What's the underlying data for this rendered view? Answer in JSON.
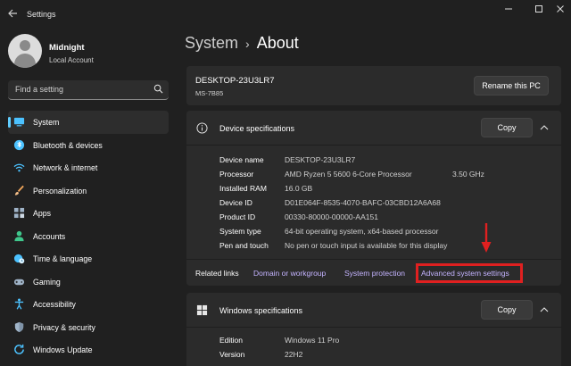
{
  "window": {
    "title": "Settings"
  },
  "profile": {
    "name": "Midnight",
    "account_type": "Local Account"
  },
  "search": {
    "placeholder": "Find a setting"
  },
  "nav": {
    "items": [
      {
        "label": "System",
        "icon": "monitor-icon",
        "color": "#4cc2ff"
      },
      {
        "label": "Bluetooth & devices",
        "icon": "bluetooth-icon",
        "color": "#4cc2ff"
      },
      {
        "label": "Network & internet",
        "icon": "wifi-icon",
        "color": "#4cc2ff"
      },
      {
        "label": "Personalization",
        "icon": "brush-icon",
        "color": "#f2a65a"
      },
      {
        "label": "Apps",
        "icon": "apps-icon",
        "color": "#a0b4c8"
      },
      {
        "label": "Accounts",
        "icon": "person-icon",
        "color": "#3fc78c"
      },
      {
        "label": "Time & language",
        "icon": "globe-clock-icon",
        "color": "#4cc2ff"
      },
      {
        "label": "Gaming",
        "icon": "gamepad-icon",
        "color": "#a0b4c8"
      },
      {
        "label": "Accessibility",
        "icon": "accessibility-icon",
        "color": "#4cc2ff"
      },
      {
        "label": "Privacy & security",
        "icon": "shield-icon",
        "color": "#a0b4c8"
      },
      {
        "label": "Windows Update",
        "icon": "update-icon",
        "color": "#4cc2ff"
      }
    ],
    "active_index": 0
  },
  "header": {
    "crumb1": "System",
    "separator": "›",
    "crumb2": "About"
  },
  "pc": {
    "name": "DESKTOP-23U3LR7",
    "model": "MS-7B85",
    "rename_label": "Rename this PC"
  },
  "device_specs": {
    "title": "Device specifications",
    "copy_label": "Copy",
    "rows": [
      {
        "label": "Device name",
        "value": "DESKTOP-23U3LR7",
        "extra": ""
      },
      {
        "label": "Processor",
        "value": "AMD Ryzen 5 5600 6-Core Processor",
        "extra": "3.50 GHz"
      },
      {
        "label": "Installed RAM",
        "value": "16.0 GB",
        "extra": ""
      },
      {
        "label": "Device ID",
        "value": "D01E064F-8535-4070-BAFC-03CBD12A6A68",
        "extra": ""
      },
      {
        "label": "Product ID",
        "value": "00330-80000-00000-AA151",
        "extra": ""
      },
      {
        "label": "System type",
        "value": "64-bit operating system, x64-based processor",
        "extra": ""
      },
      {
        "label": "Pen and touch",
        "value": "No pen or touch input is available for this display",
        "extra": ""
      }
    ]
  },
  "related": {
    "title": "Related links",
    "links": [
      "Domain or workgroup",
      "System protection",
      "Advanced system settings"
    ]
  },
  "windows_specs": {
    "title": "Windows specifications",
    "copy_label": "Copy",
    "rows": [
      {
        "label": "Edition",
        "value": "Windows 11 Pro"
      },
      {
        "label": "Version",
        "value": "22H2"
      }
    ]
  },
  "colors": {
    "accent": "#60cdff",
    "link": "#c4b3ff",
    "annotation": "#e02020"
  }
}
